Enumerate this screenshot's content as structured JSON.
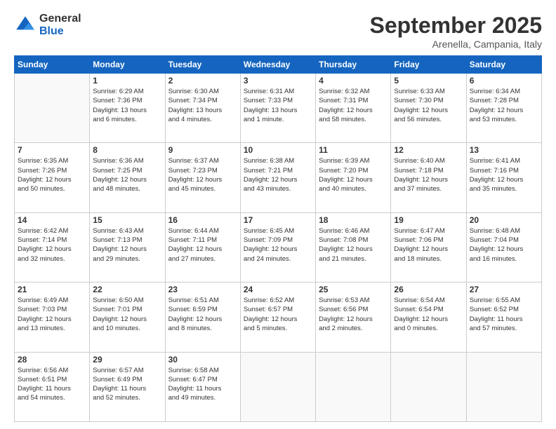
{
  "logo": {
    "general": "General",
    "blue": "Blue"
  },
  "header": {
    "month": "September 2025",
    "location": "Arenella, Campania, Italy"
  },
  "weekdays": [
    "Sunday",
    "Monday",
    "Tuesday",
    "Wednesday",
    "Thursday",
    "Friday",
    "Saturday"
  ],
  "weeks": [
    [
      {
        "day": "",
        "info": ""
      },
      {
        "day": "1",
        "info": "Sunrise: 6:29 AM\nSunset: 7:36 PM\nDaylight: 13 hours\nand 6 minutes."
      },
      {
        "day": "2",
        "info": "Sunrise: 6:30 AM\nSunset: 7:34 PM\nDaylight: 13 hours\nand 4 minutes."
      },
      {
        "day": "3",
        "info": "Sunrise: 6:31 AM\nSunset: 7:33 PM\nDaylight: 13 hours\nand 1 minute."
      },
      {
        "day": "4",
        "info": "Sunrise: 6:32 AM\nSunset: 7:31 PM\nDaylight: 12 hours\nand 58 minutes."
      },
      {
        "day": "5",
        "info": "Sunrise: 6:33 AM\nSunset: 7:30 PM\nDaylight: 12 hours\nand 56 minutes."
      },
      {
        "day": "6",
        "info": "Sunrise: 6:34 AM\nSunset: 7:28 PM\nDaylight: 12 hours\nand 53 minutes."
      }
    ],
    [
      {
        "day": "7",
        "info": "Sunrise: 6:35 AM\nSunset: 7:26 PM\nDaylight: 12 hours\nand 50 minutes."
      },
      {
        "day": "8",
        "info": "Sunrise: 6:36 AM\nSunset: 7:25 PM\nDaylight: 12 hours\nand 48 minutes."
      },
      {
        "day": "9",
        "info": "Sunrise: 6:37 AM\nSunset: 7:23 PM\nDaylight: 12 hours\nand 45 minutes."
      },
      {
        "day": "10",
        "info": "Sunrise: 6:38 AM\nSunset: 7:21 PM\nDaylight: 12 hours\nand 43 minutes."
      },
      {
        "day": "11",
        "info": "Sunrise: 6:39 AM\nSunset: 7:20 PM\nDaylight: 12 hours\nand 40 minutes."
      },
      {
        "day": "12",
        "info": "Sunrise: 6:40 AM\nSunset: 7:18 PM\nDaylight: 12 hours\nand 37 minutes."
      },
      {
        "day": "13",
        "info": "Sunrise: 6:41 AM\nSunset: 7:16 PM\nDaylight: 12 hours\nand 35 minutes."
      }
    ],
    [
      {
        "day": "14",
        "info": "Sunrise: 6:42 AM\nSunset: 7:14 PM\nDaylight: 12 hours\nand 32 minutes."
      },
      {
        "day": "15",
        "info": "Sunrise: 6:43 AM\nSunset: 7:13 PM\nDaylight: 12 hours\nand 29 minutes."
      },
      {
        "day": "16",
        "info": "Sunrise: 6:44 AM\nSunset: 7:11 PM\nDaylight: 12 hours\nand 27 minutes."
      },
      {
        "day": "17",
        "info": "Sunrise: 6:45 AM\nSunset: 7:09 PM\nDaylight: 12 hours\nand 24 minutes."
      },
      {
        "day": "18",
        "info": "Sunrise: 6:46 AM\nSunset: 7:08 PM\nDaylight: 12 hours\nand 21 minutes."
      },
      {
        "day": "19",
        "info": "Sunrise: 6:47 AM\nSunset: 7:06 PM\nDaylight: 12 hours\nand 18 minutes."
      },
      {
        "day": "20",
        "info": "Sunrise: 6:48 AM\nSunset: 7:04 PM\nDaylight: 12 hours\nand 16 minutes."
      }
    ],
    [
      {
        "day": "21",
        "info": "Sunrise: 6:49 AM\nSunset: 7:03 PM\nDaylight: 12 hours\nand 13 minutes."
      },
      {
        "day": "22",
        "info": "Sunrise: 6:50 AM\nSunset: 7:01 PM\nDaylight: 12 hours\nand 10 minutes."
      },
      {
        "day": "23",
        "info": "Sunrise: 6:51 AM\nSunset: 6:59 PM\nDaylight: 12 hours\nand 8 minutes."
      },
      {
        "day": "24",
        "info": "Sunrise: 6:52 AM\nSunset: 6:57 PM\nDaylight: 12 hours\nand 5 minutes."
      },
      {
        "day": "25",
        "info": "Sunrise: 6:53 AM\nSunset: 6:56 PM\nDaylight: 12 hours\nand 2 minutes."
      },
      {
        "day": "26",
        "info": "Sunrise: 6:54 AM\nSunset: 6:54 PM\nDaylight: 12 hours\nand 0 minutes."
      },
      {
        "day": "27",
        "info": "Sunrise: 6:55 AM\nSunset: 6:52 PM\nDaylight: 11 hours\nand 57 minutes."
      }
    ],
    [
      {
        "day": "28",
        "info": "Sunrise: 6:56 AM\nSunset: 6:51 PM\nDaylight: 11 hours\nand 54 minutes."
      },
      {
        "day": "29",
        "info": "Sunrise: 6:57 AM\nSunset: 6:49 PM\nDaylight: 11 hours\nand 52 minutes."
      },
      {
        "day": "30",
        "info": "Sunrise: 6:58 AM\nSunset: 6:47 PM\nDaylight: 11 hours\nand 49 minutes."
      },
      {
        "day": "",
        "info": ""
      },
      {
        "day": "",
        "info": ""
      },
      {
        "day": "",
        "info": ""
      },
      {
        "day": "",
        "info": ""
      }
    ]
  ]
}
